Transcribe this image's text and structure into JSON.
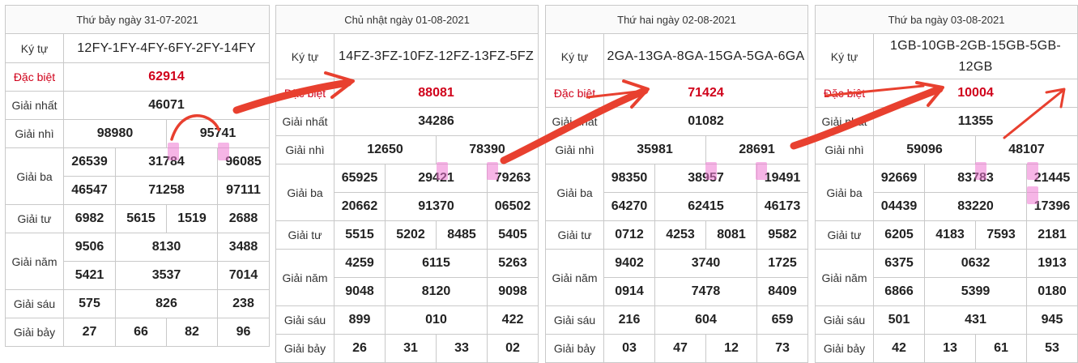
{
  "tables": [
    {
      "title": "Thứ bảy ngày 31-07-2021",
      "code_label": "Ký tự",
      "code": "12FY-1FY-4FY-6FY-2FY-14FY",
      "special_label": "Đặc biệt",
      "special": "62914",
      "first_label": "Giải nhất",
      "first": "46071",
      "second_label": "Giải nhì",
      "second": [
        "98980",
        "95741"
      ],
      "third_label": "Giải ba",
      "third": [
        "26539",
        "31784",
        "96085",
        "46547",
        "71258",
        "97111"
      ],
      "fourth_label": "Giải tư",
      "fourth": [
        "6982",
        "5615",
        "1519",
        "2688"
      ],
      "fifth_label": "Giải năm",
      "fifth": [
        "9506",
        "8130",
        "3488",
        "5421",
        "3537",
        "7014"
      ],
      "sixth_label": "Giải sáu",
      "sixth": [
        "575",
        "826",
        "238"
      ],
      "seventh_label": "Giải bảy",
      "seventh": [
        "27",
        "66",
        "82",
        "96"
      ]
    },
    {
      "title": "Chủ nhật ngày 01-08-2021",
      "code_label": "Ký tự",
      "code": "14FZ-3FZ-10FZ-12FZ-13FZ-5FZ",
      "special_label": "Đặc biệt",
      "special": "88081",
      "first_label": "Giải nhất",
      "first": "34286",
      "second_label": "Giải nhì",
      "second": [
        "12650",
        "78390"
      ],
      "third_label": "Giải ba",
      "third": [
        "65925",
        "29421",
        "79263",
        "20662",
        "91370",
        "06502"
      ],
      "fourth_label": "Giải tư",
      "fourth": [
        "5515",
        "5202",
        "8485",
        "5405"
      ],
      "fifth_label": "Giải năm",
      "fifth": [
        "4259",
        "6115",
        "5263",
        "9048",
        "8120",
        "9098"
      ],
      "sixth_label": "Giải sáu",
      "sixth": [
        "899",
        "010",
        "422"
      ],
      "seventh_label": "Giải bảy",
      "seventh": [
        "26",
        "31",
        "33",
        "02"
      ]
    },
    {
      "title": "Thứ hai ngày 02-08-2021",
      "code_label": "Ký tự",
      "code": "2GA-13GA-8GA-15GA-5GA-6GA",
      "special_label": "Đặc biệt",
      "special": "71424",
      "first_label": "Giải nhất",
      "first": "01082",
      "second_label": "Giải nhì",
      "second": [
        "35981",
        "28691"
      ],
      "third_label": "Giải ba",
      "third": [
        "98350",
        "38957",
        "19491",
        "64270",
        "62415",
        "46173"
      ],
      "fourth_label": "Giải tư",
      "fourth": [
        "0712",
        "4253",
        "8081",
        "9582"
      ],
      "fifth_label": "Giải năm",
      "fifth": [
        "9402",
        "3740",
        "1725",
        "0914",
        "7478",
        "8409"
      ],
      "sixth_label": "Giải sáu",
      "sixth": [
        "216",
        "604",
        "659"
      ],
      "seventh_label": "Giải bảy",
      "seventh": [
        "03",
        "47",
        "12",
        "73"
      ]
    },
    {
      "title": "Thứ ba ngày 03-08-2021",
      "code_label": "Ký tự",
      "code": "1GB-10GB-2GB-15GB-5GB-12GB",
      "special_label": "Đặc biệt",
      "special": "10004",
      "first_label": "Giải nhất",
      "first": "11355",
      "second_label": "Giải nhì",
      "second": [
        "59096",
        "48107"
      ],
      "third_label": "Giải ba",
      "third": [
        "92669",
        "83783",
        "21445",
        "04439",
        "83220",
        "17396"
      ],
      "fourth_label": "Giải tư",
      "fourth": [
        "6205",
        "4183",
        "7593",
        "2181"
      ],
      "fifth_label": "Giải năm",
      "fifth": [
        "6375",
        "0632",
        "1913",
        "6866",
        "5399",
        "0180"
      ],
      "sixth_label": "Giải sáu",
      "sixth": [
        "501",
        "431",
        "945"
      ],
      "seventh_label": "Giải bảy",
      "seventh": [
        "42",
        "13",
        "61",
        "53"
      ]
    }
  ],
  "colors": {
    "special": "#d0021b",
    "arrow": "#e8402f",
    "highlight": "#ee78d2",
    "border": "#c9c9c9"
  }
}
